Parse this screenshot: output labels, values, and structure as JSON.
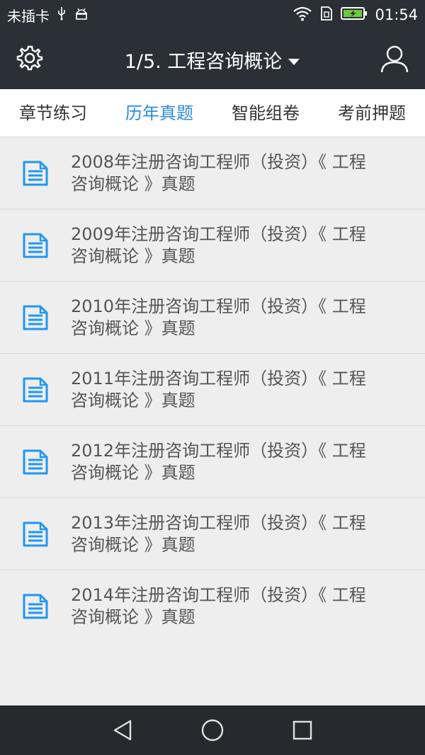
{
  "status_bar": {
    "carrier": "未插卡",
    "time": "01:54"
  },
  "app_bar": {
    "title": "1/5. 工程咨询概论"
  },
  "tabs": [
    {
      "label": "章节练习",
      "active": false
    },
    {
      "label": "历年真题",
      "active": true
    },
    {
      "label": "智能组卷",
      "active": false
    },
    {
      "label": "考前押题",
      "active": false
    }
  ],
  "items": [
    {
      "line1": "2008年注册咨询工程师（投资）《 工程",
      "line2": "咨询概论 》真题"
    },
    {
      "line1": "2009年注册咨询工程师（投资）《 工程",
      "line2": "咨询概论 》真题"
    },
    {
      "line1": "2010年注册咨询工程师（投资）《 工程",
      "line2": "咨询概论 》真题"
    },
    {
      "line1": "2011年注册咨询工程师（投资）《 工程",
      "line2": "咨询概论 》真题"
    },
    {
      "line1": "2012年注册咨询工程师（投资）《 工程",
      "line2": "咨询概论 》真题"
    },
    {
      "line1": "2013年注册咨询工程师（投资）《 工程",
      "line2": "咨询概论 》真题"
    },
    {
      "line1": "2014年注册咨询工程师（投资）《 工程",
      "line2": "咨询概论 》真题"
    }
  ],
  "colors": {
    "bar_bg": "#2a3036",
    "accent": "#2a8ae0",
    "icon_blue": "#2196f3",
    "list_bg": "#eeeeee"
  }
}
